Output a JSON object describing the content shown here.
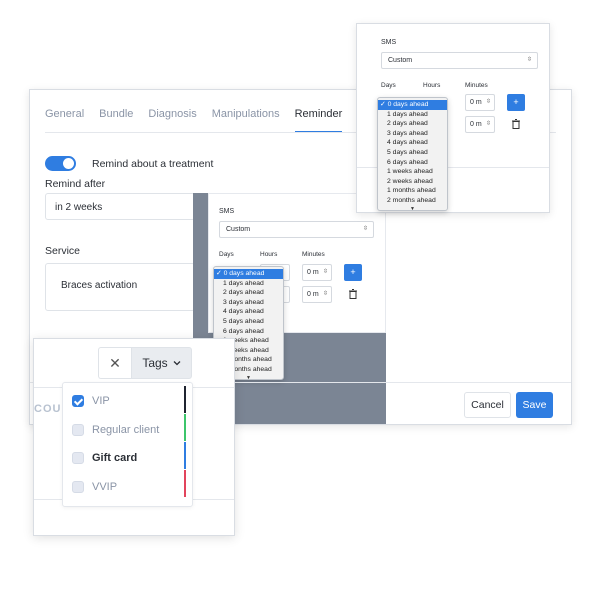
{
  "main": {
    "tabs": [
      {
        "label": "General",
        "active": false
      },
      {
        "label": "Bundle",
        "active": false
      },
      {
        "label": "Diagnosis",
        "active": false
      },
      {
        "label": "Manipulations",
        "active": false
      },
      {
        "label": "Reminder",
        "active": true
      }
    ],
    "toggle_label": "Remind about a treatment",
    "toggle_on": true,
    "remind_after_label": "Remind after",
    "remind_after_value": "in 2 weeks",
    "service_label": "Service",
    "service_value": "Braces activation",
    "cancel_label": "Cancel",
    "save_label": "Save"
  },
  "sms": {
    "title": "SMS",
    "template_value": "Custom",
    "days_label": "Days",
    "hours_label": "Hours",
    "minutes_label": "Minutes",
    "minutes_value": "0 m",
    "plus_label": "+"
  },
  "days_options": [
    "0 days ahead",
    "1 days ahead",
    "2 days ahead",
    "3 days ahead",
    "4 days ahead",
    "5 days ahead",
    "6 days ahead",
    "1 weeks ahead",
    "2 weeks ahead",
    "1 months ahead",
    "2 months ahead"
  ],
  "days_selected": "✓ 0 days ahead",
  "tags": {
    "close_label": "✕",
    "button_label": "Tags",
    "partial_text": "COU",
    "items": [
      {
        "label": "VIP",
        "checked": true,
        "color": "#1f2430"
      },
      {
        "label": "Regular client",
        "checked": false,
        "color": "#3cc56b"
      },
      {
        "label": "Gift card",
        "checked": false,
        "color": "#2f7de1"
      },
      {
        "label": "VVIP",
        "checked": false,
        "color": "#e2445c"
      }
    ]
  },
  "colors": {
    "accent": "#2f7de1",
    "panel_gray": "#7b8594"
  }
}
